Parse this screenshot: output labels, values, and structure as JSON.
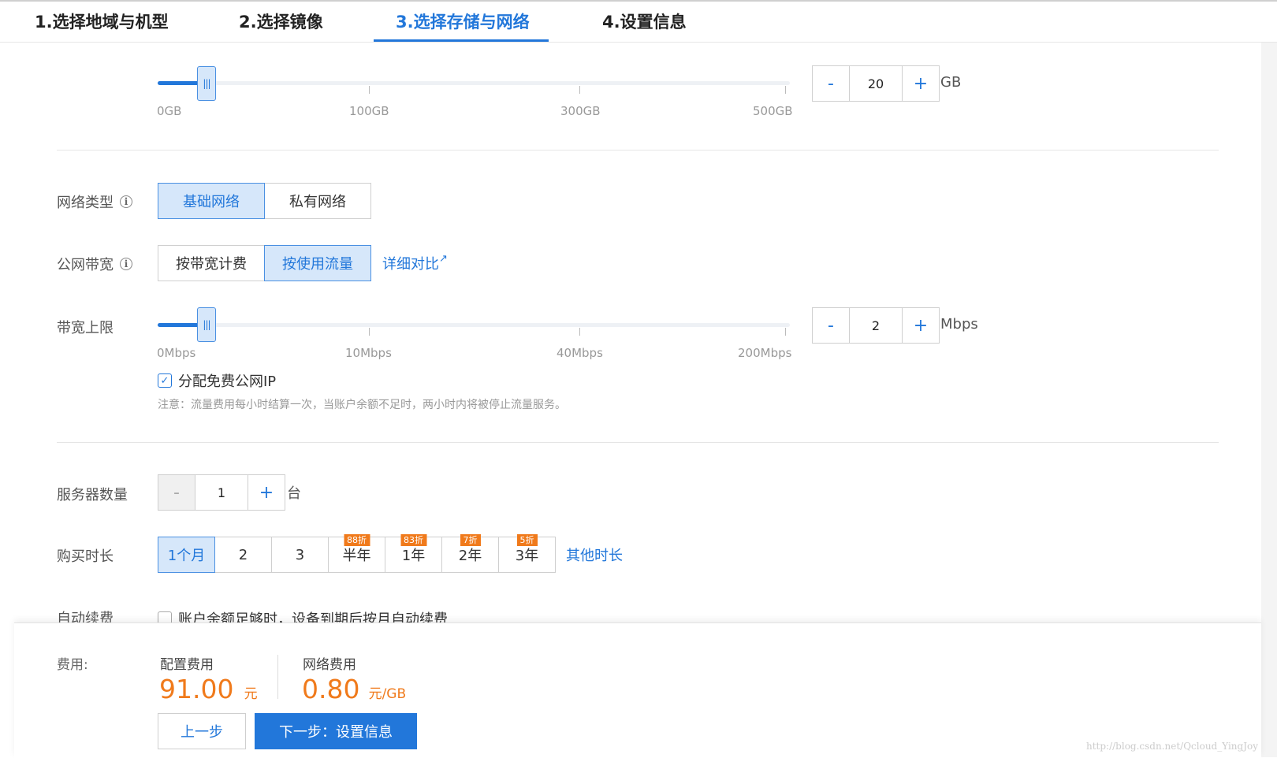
{
  "tabs": [
    {
      "label": "1.选择地域与机型"
    },
    {
      "label": "2.选择镜像"
    },
    {
      "label": "3.选择存储与网络"
    },
    {
      "label": "4.设置信息"
    }
  ],
  "storage": {
    "slider_fraction": 0.077,
    "ticks": [
      "0GB",
      "100GB",
      "300GB",
      "500GB"
    ],
    "stepper": {
      "minus": "-",
      "value": "20",
      "plus": "+"
    },
    "unit": "GB"
  },
  "network_type": {
    "label": "网络类型",
    "options": [
      "基础网络",
      "私有网络"
    ],
    "selected": "基础网络"
  },
  "bandwidth_billing": {
    "label": "公网带宽",
    "options": [
      "按带宽计费",
      "按使用流量"
    ],
    "selected": "按使用流量",
    "compare_link": "详细对比"
  },
  "bandwidth_limit": {
    "label": "带宽上限",
    "slider_fraction": 0.077,
    "ticks": [
      "0Mbps",
      "10Mbps",
      "40Mbps",
      "200Mbps"
    ],
    "stepper": {
      "minus": "-",
      "value": "2",
      "plus": "+"
    },
    "unit": "Mbps",
    "free_ip_label": "分配免费公网IP",
    "free_ip_checked": true,
    "note": "注意：流量费用每小时结算一次，当账户余额不足时，两小时内将被停止流量服务。"
  },
  "server_count": {
    "label": "服务器数量",
    "stepper": {
      "minus": "-",
      "value": "1",
      "plus": "+"
    },
    "unit": "台"
  },
  "purchase_duration": {
    "label": "购买时长",
    "options": [
      {
        "label": "1个月",
        "badge": ""
      },
      {
        "label": "2",
        "badge": ""
      },
      {
        "label": "3",
        "badge": ""
      },
      {
        "label": "半年",
        "badge": "88折"
      },
      {
        "label": "1年",
        "badge": "83折"
      },
      {
        "label": "2年",
        "badge": "7折"
      },
      {
        "label": "3年",
        "badge": "5折"
      }
    ],
    "selected": "1个月",
    "other_link": "其他时长"
  },
  "auto_renew": {
    "label": "自动续费",
    "text": "账户余额足够时，设备到期后按月自动续费"
  },
  "footer": {
    "fee_label": "费用:",
    "config_fee_title": "配置费用",
    "config_fee_price": "91.00",
    "config_fee_unit": "元",
    "network_fee_title": "网络费用",
    "network_fee_price": "0.80",
    "network_fee_unit": "元/GB",
    "prev_button": "上一步",
    "next_button": "下一步：设置信息"
  },
  "watermark": "http://blog.csdn.net/Qcloud_YingJoy",
  "colors": {
    "accent": "#2277da",
    "accent_light": "#d6e7fa",
    "price": "#f07a1b",
    "badge": "#f07a1b"
  }
}
